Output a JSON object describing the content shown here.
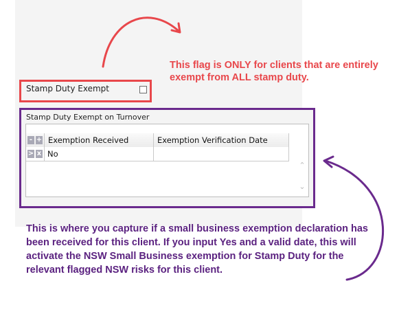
{
  "stamp_duty": {
    "label": "Stamp Duty Exempt",
    "checked": false
  },
  "group": {
    "title": "Stamp Duty Exempt on Turnover",
    "grid": {
      "header_buttons": [
        "-",
        "+"
      ],
      "row_buttons": [
        ">",
        "x"
      ],
      "columns": [
        "Exemption Received",
        "Exemption Verification Date"
      ],
      "rows": [
        [
          "No",
          ""
        ]
      ]
    }
  },
  "annotations": {
    "red_note": "This flag is ONLY for clients that are entirely exempt from ALL stamp duty.",
    "purple_note": "This is where you capture if a small business exemption declaration has been received for this client.  If you input Yes and a valid date, this will activate the NSW Small Business exemption for Stamp Duty for the relevant flagged NSW risks for this client."
  },
  "colors": {
    "red": "#e8474b",
    "purple": "#6a2a8d",
    "purple_text": "#5b2280"
  }
}
